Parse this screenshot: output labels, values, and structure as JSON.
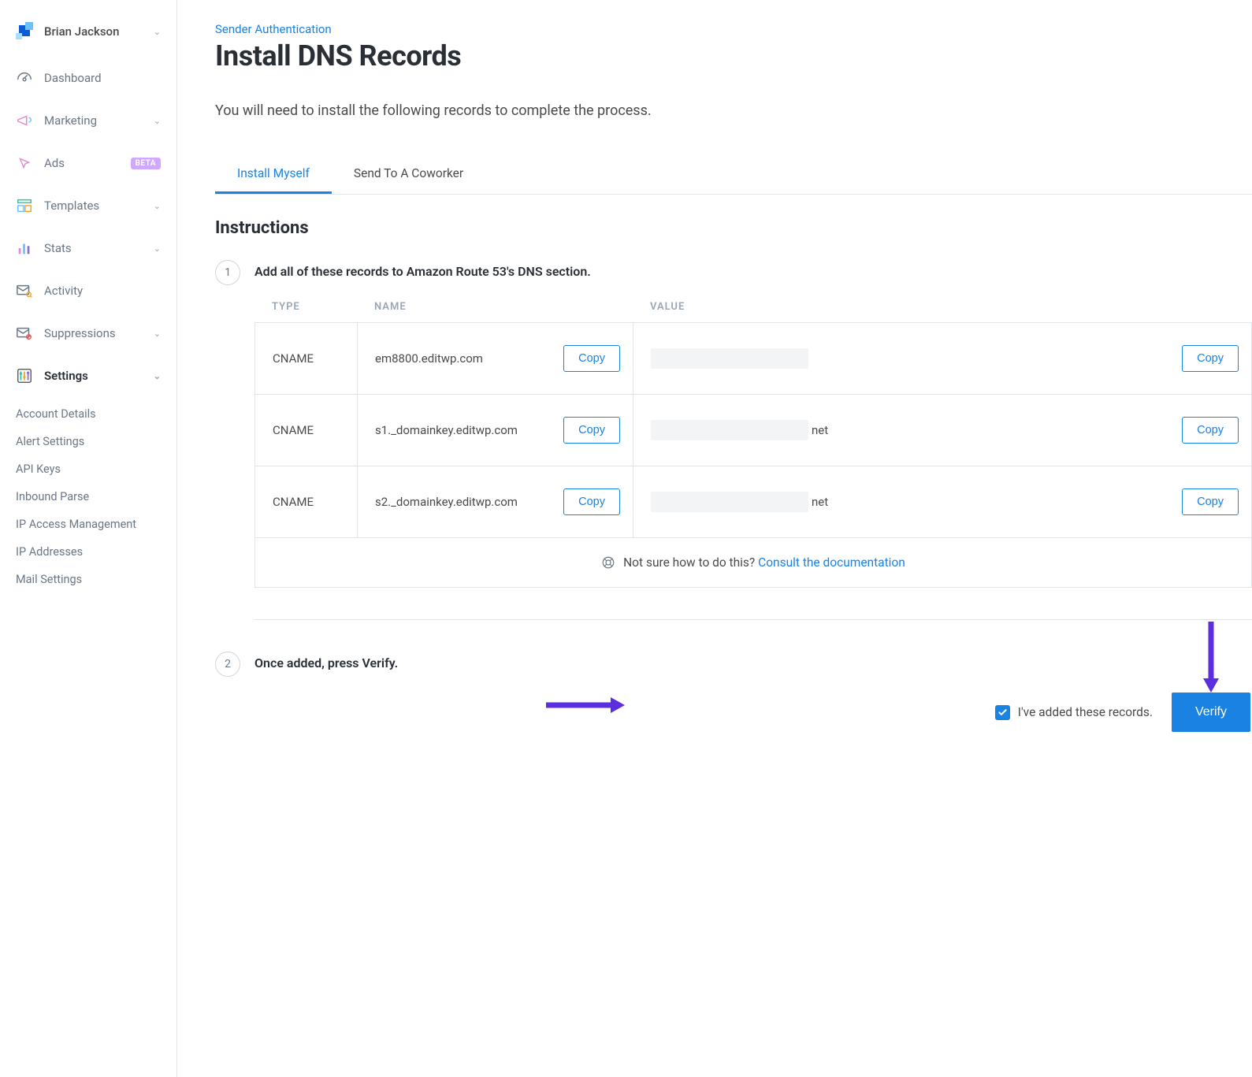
{
  "user": {
    "name": "Brian Jackson"
  },
  "sidebar": {
    "items": [
      {
        "label": "Dashboard",
        "icon": "gauge-icon"
      },
      {
        "label": "Marketing",
        "icon": "megaphone-icon",
        "expandable": true
      },
      {
        "label": "Ads",
        "icon": "cursor-icon",
        "badge": "BETA"
      },
      {
        "label": "Templates",
        "icon": "layout-icon",
        "expandable": true
      },
      {
        "label": "Stats",
        "icon": "bars-icon",
        "expandable": true
      },
      {
        "label": "Activity",
        "icon": "mail-search-icon"
      },
      {
        "label": "Suppressions",
        "icon": "mail-block-icon",
        "expandable": true
      },
      {
        "label": "Settings",
        "icon": "sliders-icon",
        "expandable": true,
        "active": true
      }
    ],
    "settings_sub": [
      "Account Details",
      "Alert Settings",
      "API Keys",
      "Inbound Parse",
      "IP Access Management",
      "IP Addresses",
      "Mail Settings"
    ]
  },
  "breadcrumb": "Sender Authentication",
  "page_title": "Install DNS Records",
  "subtitle": "You will need to install the following records to complete the process.",
  "tabs": [
    {
      "label": "Install Myself",
      "active": true
    },
    {
      "label": "Send To A Coworker"
    }
  ],
  "section_title": "Instructions",
  "step1": {
    "num": "1",
    "text": "Add all of these records to Amazon Route 53's DNS section."
  },
  "table": {
    "headers": {
      "type": "TYPE",
      "name": "NAME",
      "value": "VALUE"
    },
    "rows": [
      {
        "type": "CNAME",
        "name": "em8800.editwp.com",
        "value_suffix": ""
      },
      {
        "type": "CNAME",
        "name": "s1._domainkey.editwp.com",
        "value_suffix": "net"
      },
      {
        "type": "CNAME",
        "name": "s2._domainkey.editwp.com",
        "value_suffix": "net"
      }
    ],
    "copy_label": "Copy"
  },
  "hint": {
    "text": "Not sure how to do this? ",
    "link": "Consult the documentation"
  },
  "step2": {
    "num": "2",
    "text": "Once added, press Verify."
  },
  "checkbox_label": "I've added these records.",
  "verify_label": "Verify",
  "colors": {
    "accent": "#1a82e2",
    "arrow": "#5b2ee0"
  }
}
